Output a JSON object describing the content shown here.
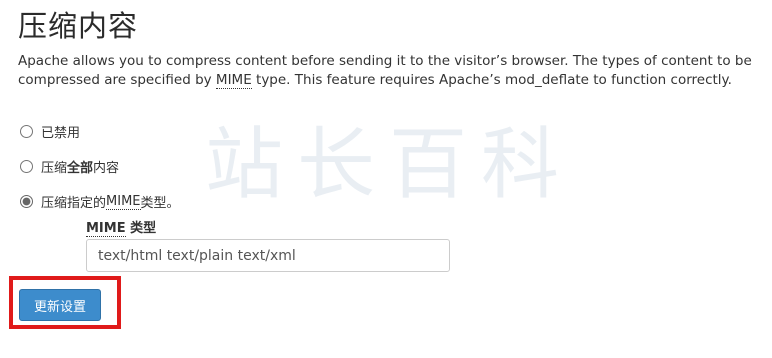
{
  "page": {
    "title": "压缩内容",
    "description_before": "Apache allows you to compress content before sending it to the visitor’s browser. The types of content to be compressed are specified by ",
    "description_abbr": "MIME",
    "description_after": " type. This feature requires Apache’s mod_deflate to function correctly."
  },
  "watermark": "站长百科",
  "options": [
    {
      "label_pre": "已禁用",
      "label_bold": "",
      "label_post": "",
      "checked": false
    },
    {
      "label_pre": "压缩",
      "label_bold": "全部",
      "label_post": "内容",
      "checked": false
    },
    {
      "label_pre": "压缩指定的 ",
      "label_abbr": "MIME",
      "label_post": "类型。",
      "checked": true
    }
  ],
  "mime_field": {
    "label_abbr": "MIME",
    "label_text": " 类型",
    "value": "text/html text/plain text/xml"
  },
  "update_button": {
    "label": "更新设置"
  },
  "colors": {
    "accent": "#3d8ccc",
    "highlight": "#e01a1a"
  }
}
